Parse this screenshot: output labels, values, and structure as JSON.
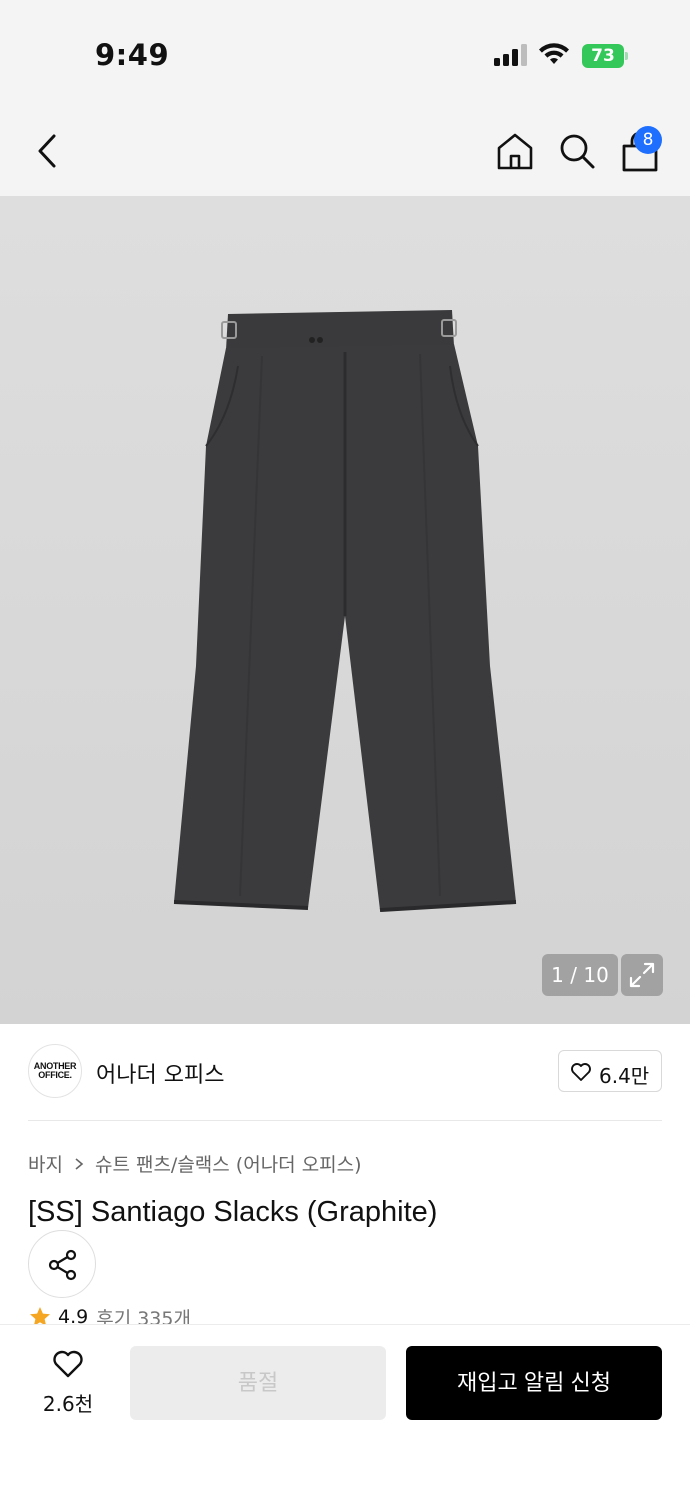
{
  "status_bar": {
    "time": "9:49",
    "battery_percent": "73"
  },
  "nav": {
    "cart_count": "8"
  },
  "gallery": {
    "counter": "1 / 10",
    "current_index": 1,
    "total": 10
  },
  "brand": {
    "logo_line1": "ANOTHER",
    "logo_line2": "OFFICE.",
    "name": "어나더 오피스",
    "like_count": "6.4만"
  },
  "product": {
    "breadcrumb_category": "바지",
    "breadcrumb_subcategory": "슈트 팬츠/슬랙스 (어나더 오피스)",
    "title": "[SS] Santiago Slacks (Graphite)",
    "rating": "4.9",
    "reviews": "후기 335개"
  },
  "bottom_bar": {
    "wish_count": "2.6천",
    "soldout_label": "품절",
    "restock_label": "재입고 알림 신청"
  },
  "colors": {
    "accent_badge": "#1f6fff",
    "battery_green": "#34c759",
    "star": "#f5a623",
    "primary_button": "#000000",
    "disabled_button": "#ececec"
  },
  "icons": {
    "back": "chevron-left-icon",
    "home": "home-icon",
    "search": "search-icon",
    "cart": "shopping-bag-icon",
    "expand": "expand-icon",
    "like": "heart-icon",
    "share": "share-icon",
    "star": "star-icon"
  }
}
